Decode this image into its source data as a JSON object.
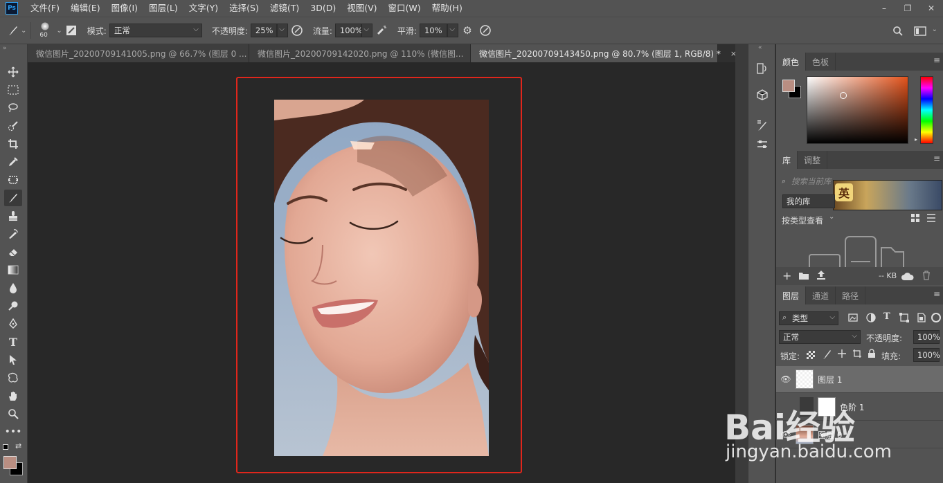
{
  "app": {
    "logo": "Ps"
  },
  "menu": [
    "文件(F)",
    "编辑(E)",
    "图像(I)",
    "图层(L)",
    "文字(Y)",
    "选择(S)",
    "滤镜(T)",
    "3D(D)",
    "视图(V)",
    "窗口(W)",
    "帮助(H)"
  ],
  "window_controls": [
    "–",
    "❐",
    "✕"
  ],
  "options": {
    "brush_size": "60",
    "mode_label": "模式:",
    "mode_value": "正常",
    "opacity_label": "不透明度:",
    "opacity_value": "25%",
    "flow_label": "流量:",
    "flow_value": "100%",
    "smooth_label": "平滑:",
    "smooth_value": "10%"
  },
  "tabs": [
    {
      "label": "微信图片_20200709141005.png @ 66.7% (图层 0 ...",
      "close": "×"
    },
    {
      "label": "微信图片_20200709142020.png @ 110% (微信图...",
      "close": "×"
    },
    {
      "label": "微信图片_20200709143450.png @ 80.7% (图层 1, RGB/8) *",
      "close": "×"
    }
  ],
  "tools": [
    "move-tool",
    "marquee-tool",
    "lasso-tool",
    "quick-select-tool",
    "crop-tool",
    "eyedropper-tool",
    "frame-tool",
    "brush-tool",
    "stamp-tool",
    "history-brush-tool",
    "eraser-tool",
    "gradient-tool",
    "blur-tool",
    "dodge-tool",
    "pen-tool",
    "type-tool",
    "path-select-tool",
    "shape-tool",
    "hand-tool",
    "zoom-tool",
    "more-tools"
  ],
  "colors": {
    "foreground": "#b98e82",
    "background": "#000000",
    "frame": "#e0261c"
  },
  "color_panel": {
    "tabs": [
      "颜色",
      "色板"
    ]
  },
  "library_panel": {
    "tabs": [
      "库",
      "调整"
    ],
    "search_placeholder": "搜索当前库",
    "library_name": "我的库",
    "view_by": "按类型查看",
    "size": "-- KB"
  },
  "layers_panel": {
    "tabs": [
      "图层",
      "通道",
      "路径"
    ],
    "filter": "类型",
    "blend_mode": "正常",
    "opacity_label": "不透明度:",
    "opacity_value": "100%",
    "lock_label": "锁定:",
    "fill_label": "填充:",
    "fill_value": "100%",
    "layers": [
      {
        "name": "图层 1",
        "selected": true
      },
      {
        "name": "色阶 1",
        "selected": false
      },
      {
        "name": "图层 0",
        "selected": false
      }
    ]
  },
  "watermark": {
    "logo": "Bai经验",
    "url": "jingyan.baidu.com"
  }
}
